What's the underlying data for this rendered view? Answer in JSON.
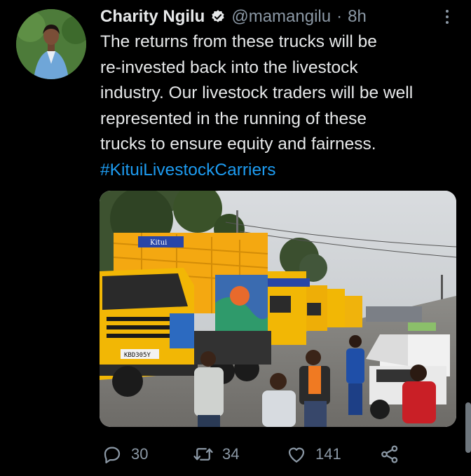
{
  "tweet": {
    "author_name": "Charity Ngilu",
    "handle": "@mamangilu",
    "separator": "·",
    "time": "8h",
    "text_lines": [
      "The returns from these trucks will be",
      "re-invested back into the livestock",
      "industry. Our livestock traders will be well",
      "represented in the running of these",
      "trucks to ensure equity and fairness."
    ],
    "hashtag": "#KituiLivestockCarriers",
    "truck_labels": {
      "plate": "KBD305Y",
      "signage": "Kitui"
    }
  },
  "actions": {
    "replies": "30",
    "retweets": "34",
    "likes": "141"
  },
  "colors": {
    "background": "#000000",
    "text": "#e7e9ea",
    "muted": "#8b98a5",
    "link": "#1d9bf0",
    "truck_yellow": "#f2b705"
  }
}
